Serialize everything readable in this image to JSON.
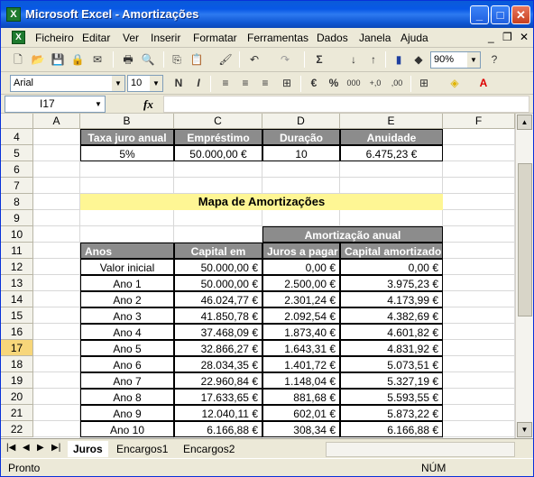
{
  "window": {
    "title": "Microsoft Excel - Amortizações"
  },
  "menu": [
    "Ficheiro",
    "Editar",
    "Ver",
    "Inserir",
    "Formatar",
    "Ferramentas",
    "Dados",
    "Janela",
    "Ajuda"
  ],
  "toolbar": {
    "zoom": "90%",
    "font": "Arial",
    "size": "10",
    "bold": "N",
    "italic": "I",
    "underline": "S",
    "currency": "€",
    "percent": "%",
    "thousands": "000",
    "inc_dec": "+,0",
    "dec_dec": ",00"
  },
  "namebox": "I17",
  "fx_label": "fx",
  "columns": [
    "A",
    "B",
    "C",
    "D",
    "E",
    "F"
  ],
  "rows": [
    "4",
    "5",
    "6",
    "7",
    "8",
    "9",
    "10",
    "11",
    "12",
    "13",
    "14",
    "15",
    "16",
    "17",
    "18",
    "19",
    "20",
    "21",
    "22"
  ],
  "selected_row": "17",
  "params": {
    "headers": [
      "Taxa juro anual",
      "Empréstimo",
      "Duração",
      "Anuidade"
    ],
    "values": [
      "5%",
      "50.000,00 €",
      "10",
      "6.475,23 €"
    ]
  },
  "map_title": "Mapa de Amortizações",
  "amort_header": "Amortização anual",
  "table_headers": [
    "Anos",
    "Capital em",
    "Juros a pagar",
    "Capital amortizado"
  ],
  "table_rows": [
    [
      "Valor inicial",
      "50.000,00 €",
      "0,00 €",
      "0,00 €"
    ],
    [
      "Ano 1",
      "50.000,00 €",
      "2.500,00 €",
      "3.975,23 €"
    ],
    [
      "Ano 2",
      "46.024,77 €",
      "2.301,24 €",
      "4.173,99 €"
    ],
    [
      "Ano 3",
      "41.850,78 €",
      "2.092,54 €",
      "4.382,69 €"
    ],
    [
      "Ano 4",
      "37.468,09 €",
      "1.873,40 €",
      "4.601,82 €"
    ],
    [
      "Ano 5",
      "32.866,27 €",
      "1.643,31 €",
      "4.831,92 €"
    ],
    [
      "Ano 6",
      "28.034,35 €",
      "1.401,72 €",
      "5.073,51 €"
    ],
    [
      "Ano 7",
      "22.960,84 €",
      "1.148,04 €",
      "5.327,19 €"
    ],
    [
      "Ano 8",
      "17.633,65 €",
      "881,68 €",
      "5.593,55 €"
    ],
    [
      "Ano 9",
      "12.040,11 €",
      "602,01 €",
      "5.873,22 €"
    ],
    [
      "Ano 10",
      "6.166,88 €",
      "308,34 €",
      "6.166,88 €"
    ]
  ],
  "sheets": [
    "Juros",
    "Encargos1",
    "Encargos2"
  ],
  "status": {
    "left": "Pronto",
    "num": "NÚM"
  }
}
